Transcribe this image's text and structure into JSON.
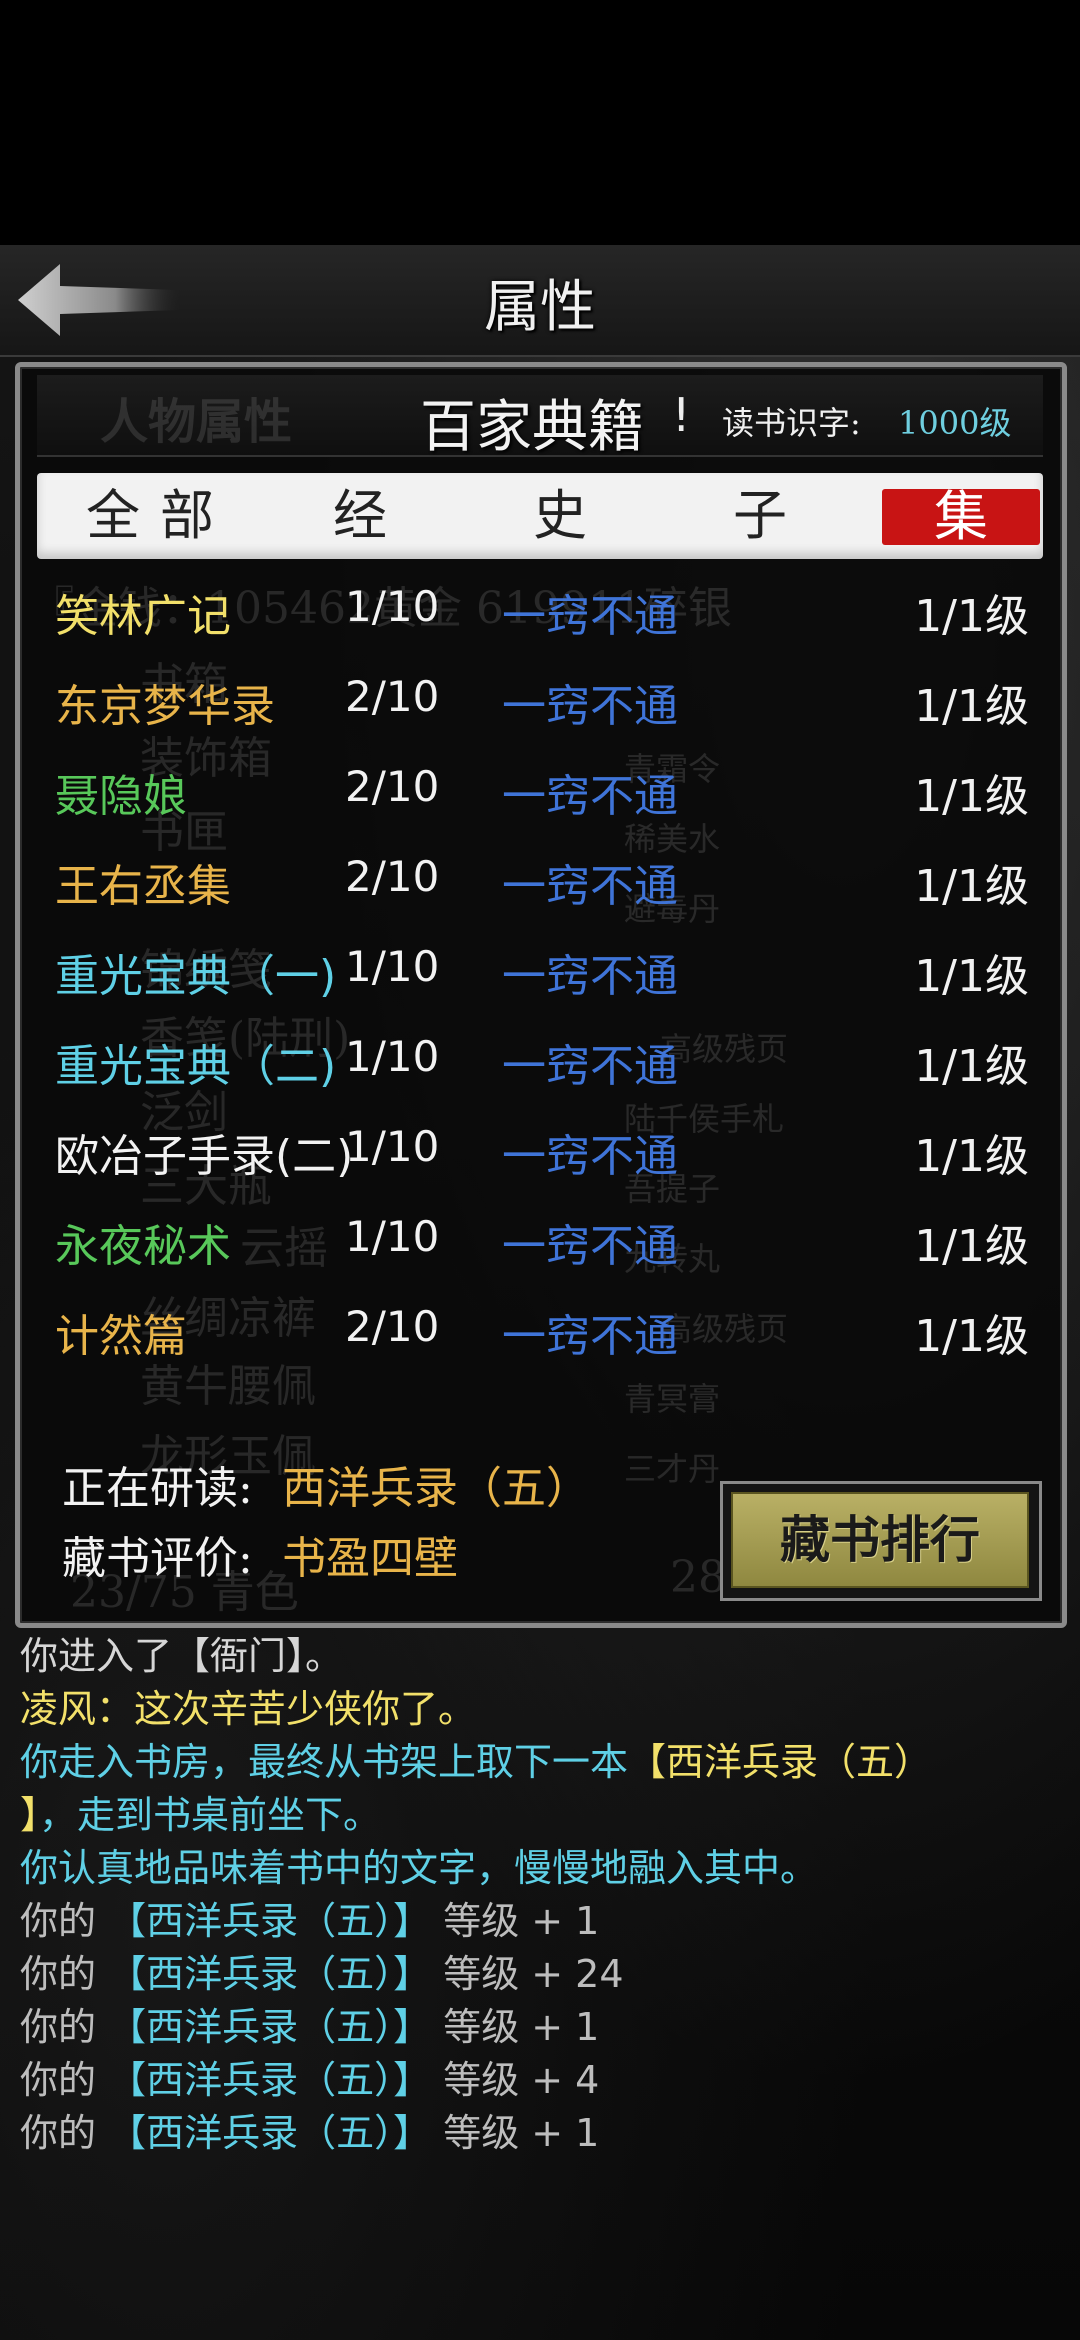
{
  "colors": {
    "gold": "#e8b44a",
    "yellow": "#f2e06a",
    "green": "#58c85a",
    "cyan": "#5fd0e6",
    "white": "#f2f2f2",
    "blue": "#3f74d8",
    "tab_active": "#c81414"
  },
  "header": {
    "title": "属性",
    "back_icon": "left-arrow-icon"
  },
  "panel": {
    "ghost_title": "人物属性",
    "title": "百家典籍",
    "alert_mark": "!",
    "literacy_label": "读书识字:",
    "literacy_value": "1000级"
  },
  "tabs": [
    {
      "label": "全部"
    },
    {
      "label": "经"
    },
    {
      "label": "史"
    },
    {
      "label": "子"
    },
    {
      "label": "集",
      "active": true
    }
  ],
  "ghost_bg": [
    {
      "text": "『金钱：105462黄金 619911碎银"
    },
    {
      "text": "书箱"
    },
    {
      "text": "装饰箱"
    },
    {
      "text": "书匣"
    },
    {
      "text": "锦绣笺"
    },
    {
      "text": "香笺(陆刑)"
    },
    {
      "text": "泛剑"
    },
    {
      "text": "三大瓶"
    },
    {
      "text": "云摇"
    },
    {
      "text": "丝绸凉裤"
    },
    {
      "text": "黄牛腰佩"
    },
    {
      "text": "龙形玉佩"
    },
    {
      "text": "23/75 青色"
    },
    {
      "text": "28"
    },
    {
      "text": "青霜令"
    },
    {
      "text": "稀美水"
    },
    {
      "text": "避毒丹"
    },
    {
      "text": "高级残页"
    },
    {
      "text": "陆千侯手札"
    },
    {
      "text": "吾提子"
    },
    {
      "text": "九转丸"
    },
    {
      "text": "高级残页"
    },
    {
      "text": "青冥膏"
    },
    {
      "text": "三才丹"
    }
  ],
  "books": [
    {
      "name": "笑林广记",
      "color": "yellow",
      "progress": "1/10",
      "status": "一窍不通",
      "level": "1/1级"
    },
    {
      "name": "东京梦华录",
      "color": "gold",
      "progress": "2/10",
      "status": "一窍不通",
      "level": "1/1级"
    },
    {
      "name": "聂隐娘",
      "color": "green",
      "progress": "2/10",
      "status": "一窍不通",
      "level": "1/1级"
    },
    {
      "name": "王右丞集",
      "color": "gold",
      "progress": "2/10",
      "status": "一窍不通",
      "level": "1/1级"
    },
    {
      "name": "重光宝典（一)",
      "color": "cyan",
      "progress": "1/10",
      "status": "一窍不通",
      "level": "1/1级"
    },
    {
      "name": "重光宝典（二)",
      "color": "cyan",
      "progress": "1/10",
      "status": "一窍不通",
      "level": "1/1级"
    },
    {
      "name": "欧冶子手录(二)",
      "color": "white",
      "progress": "1/10",
      "status": "一窍不通",
      "level": "1/1级"
    },
    {
      "name": "永夜秘术",
      "color": "green",
      "progress": "1/10",
      "status": "一窍不通",
      "level": "1/1级"
    },
    {
      "name": "计然篇",
      "color": "gold",
      "progress": "2/10",
      "status": "一窍不通",
      "level": "1/1级"
    }
  ],
  "footer": {
    "studying_label": "正在研读:",
    "studying_value": "西洋兵录（五）",
    "rating_label": "藏书评价:",
    "rating_value": "书盈四壁",
    "ranking_button": "藏书排行"
  },
  "log": [
    {
      "parts": [
        {
          "t": "你进入了【衙门】。",
          "c": "white"
        }
      ]
    },
    {
      "parts": [
        {
          "t": "凌风：这次辛苦少侠你了。",
          "c": "yellow"
        }
      ]
    },
    {
      "parts": [
        {
          "t": "你走入书房，最终从书架上取下一本",
          "c": "cyan"
        },
        {
          "t": "【西洋兵录（五）",
          "c": "yellow"
        }
      ]
    },
    {
      "parts": [
        {
          "t": "】",
          "c": "yellow"
        },
        {
          "t": "，走到书桌前坐下。",
          "c": "cyan"
        }
      ]
    },
    {
      "parts": [
        {
          "t": "你认真地品味着书中的文字，慢慢地融入其中。",
          "c": "cyan"
        }
      ]
    },
    {
      "parts": [
        {
          "t": "你的 ",
          "c": "white"
        },
        {
          "t": "【西洋兵录（五）】",
          "c": "cyan"
        },
        {
          "t": " 等级 + 1",
          "c": "white"
        }
      ]
    },
    {
      "parts": [
        {
          "t": "你的 ",
          "c": "white"
        },
        {
          "t": "【西洋兵录（五）】",
          "c": "cyan"
        },
        {
          "t": " 等级 + 24",
          "c": "white"
        }
      ]
    },
    {
      "parts": [
        {
          "t": "你的 ",
          "c": "white"
        },
        {
          "t": "【西洋兵录（五）】",
          "c": "cyan"
        },
        {
          "t": " 等级 + 1",
          "c": "white"
        }
      ]
    },
    {
      "parts": [
        {
          "t": "你的 ",
          "c": "white"
        },
        {
          "t": "【西洋兵录（五）】",
          "c": "cyan"
        },
        {
          "t": " 等级 + 4",
          "c": "white"
        }
      ]
    },
    {
      "parts": [
        {
          "t": "你的 ",
          "c": "white"
        },
        {
          "t": "【西洋兵录（五）】",
          "c": "cyan"
        },
        {
          "t": " 等级 + 1",
          "c": "white"
        }
      ]
    }
  ]
}
